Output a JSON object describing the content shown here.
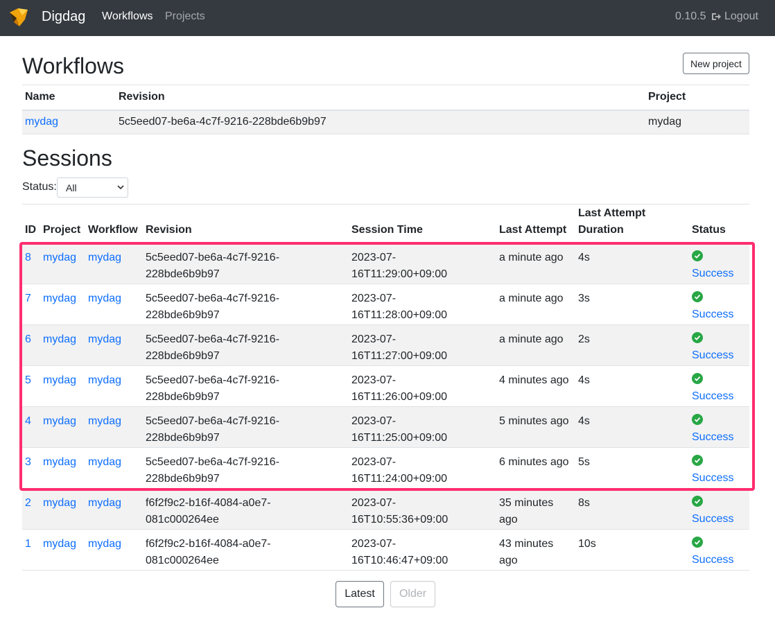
{
  "navbar": {
    "brand": "Digdag",
    "links": {
      "workflows": "Workflows",
      "projects": "Projects"
    },
    "version": "0.10.5",
    "logout": "Logout"
  },
  "workflows": {
    "title": "Workflows",
    "new_project_label": "New project",
    "columns": {
      "name": "Name",
      "revision": "Revision",
      "project": "Project"
    },
    "rows": [
      {
        "name": "mydag",
        "revision": "5c5eed07-be6a-4c7f-9216-228bde6b9b97",
        "project": "mydag"
      }
    ]
  },
  "sessions": {
    "title": "Sessions",
    "status_label": "Status:",
    "status_selected": "All",
    "columns": {
      "id": "ID",
      "project": "Project",
      "workflow": "Workflow",
      "revision": "Revision",
      "session_time": "Session Time",
      "last_attempt": "Last Attempt",
      "duration": "Last Attempt Duration",
      "status": "Status"
    },
    "rows": [
      {
        "id": "8",
        "project": "mydag",
        "workflow": "mydag",
        "revision": "5c5eed07-be6a-4c7f-9216-228bde6b9b97",
        "session_time": "2023-07-16T11:29:00+09:00",
        "last_attempt": "a minute ago",
        "duration": "4s",
        "status": "Success"
      },
      {
        "id": "7",
        "project": "mydag",
        "workflow": "mydag",
        "revision": "5c5eed07-be6a-4c7f-9216-228bde6b9b97",
        "session_time": "2023-07-16T11:28:00+09:00",
        "last_attempt": "a minute ago",
        "duration": "3s",
        "status": "Success"
      },
      {
        "id": "6",
        "project": "mydag",
        "workflow": "mydag",
        "revision": "5c5eed07-be6a-4c7f-9216-228bde6b9b97",
        "session_time": "2023-07-16T11:27:00+09:00",
        "last_attempt": "a minute ago",
        "duration": "2s",
        "status": "Success"
      },
      {
        "id": "5",
        "project": "mydag",
        "workflow": "mydag",
        "revision": "5c5eed07-be6a-4c7f-9216-228bde6b9b97",
        "session_time": "2023-07-16T11:26:00+09:00",
        "last_attempt": "4 minutes ago",
        "duration": "4s",
        "status": "Success"
      },
      {
        "id": "4",
        "project": "mydag",
        "workflow": "mydag",
        "revision": "5c5eed07-be6a-4c7f-9216-228bde6b9b97",
        "session_time": "2023-07-16T11:25:00+09:00",
        "last_attempt": "5 minutes ago",
        "duration": "4s",
        "status": "Success"
      },
      {
        "id": "3",
        "project": "mydag",
        "workflow": "mydag",
        "revision": "5c5eed07-be6a-4c7f-9216-228bde6b9b97",
        "session_time": "2023-07-16T11:24:00+09:00",
        "last_attempt": "6 minutes ago",
        "duration": "5s",
        "status": "Success"
      },
      {
        "id": "2",
        "project": "mydag",
        "workflow": "mydag",
        "revision": "f6f2f9c2-b16f-4084-a0e7-081c000264ee",
        "session_time": "2023-07-16T10:55:36+09:00",
        "last_attempt": "35 minutes ago",
        "duration": "8s",
        "status": "Success"
      },
      {
        "id": "1",
        "project": "mydag",
        "workflow": "mydag",
        "revision": "f6f2f9c2-b16f-4084-a0e7-081c000264ee",
        "session_time": "2023-07-16T10:46:47+09:00",
        "last_attempt": "43 minutes ago",
        "duration": "10s",
        "status": "Success"
      }
    ]
  },
  "pagination": {
    "latest": "Latest",
    "older": "Older"
  },
  "colors": {
    "navbar_bg": "#343a40",
    "link": "#0d6efd",
    "success": "#28a745",
    "highlight": "#ff2d6f"
  }
}
